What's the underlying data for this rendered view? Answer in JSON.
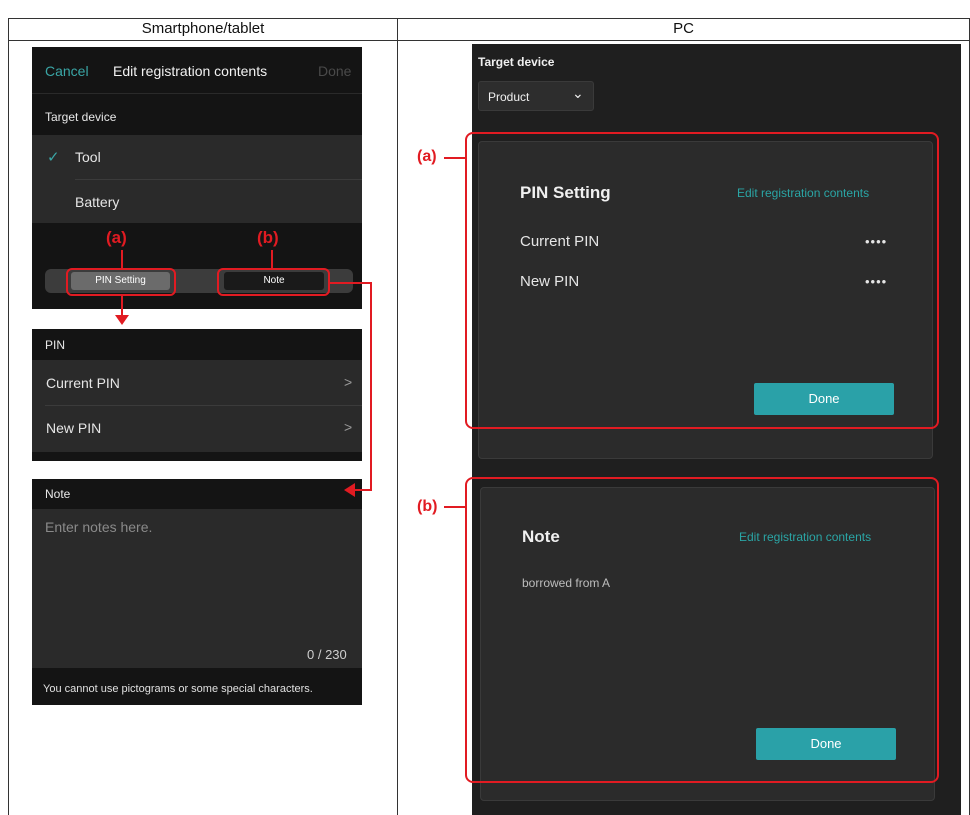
{
  "headers": {
    "left": "Smartphone/tablet",
    "right": "PC"
  },
  "phone": {
    "nav": {
      "cancel": "Cancel",
      "title": "Edit registration contents",
      "done": "Done"
    },
    "target_device": {
      "label": "Target device",
      "options": [
        "Tool",
        "Battery"
      ],
      "selected": "Tool",
      "check": "✓"
    },
    "segments": {
      "pin": "PIN Setting",
      "note": "Note"
    },
    "pin_section": {
      "label": "PIN",
      "rows": [
        "Current PIN",
        "New PIN"
      ],
      "chevron": ">"
    },
    "note_section": {
      "label": "Note",
      "placeholder": "Enter notes here.",
      "counter": "0 / 230",
      "warning": "You cannot use pictograms or some special characters."
    }
  },
  "pc": {
    "target_device": {
      "label": "Target device",
      "selected": "Product",
      "chevron": "⌄"
    },
    "pin_card": {
      "title": "PIN Setting",
      "link": "Edit registration contents",
      "rows": [
        {
          "label": "Current PIN",
          "value": "••••"
        },
        {
          "label": "New PIN",
          "value": "••••"
        }
      ],
      "done": "Done"
    },
    "note_card": {
      "title": "Note",
      "link": "Edit registration contents",
      "text": "borrowed from A",
      "done": "Done"
    }
  },
  "annotations": {
    "a": "(a)",
    "b": "(b)"
  },
  "colors": {
    "accent": "#2aa1a8",
    "annotation": "#e11b22",
    "phone_bg": "#141414",
    "card_bg": "#2b2b2b"
  }
}
